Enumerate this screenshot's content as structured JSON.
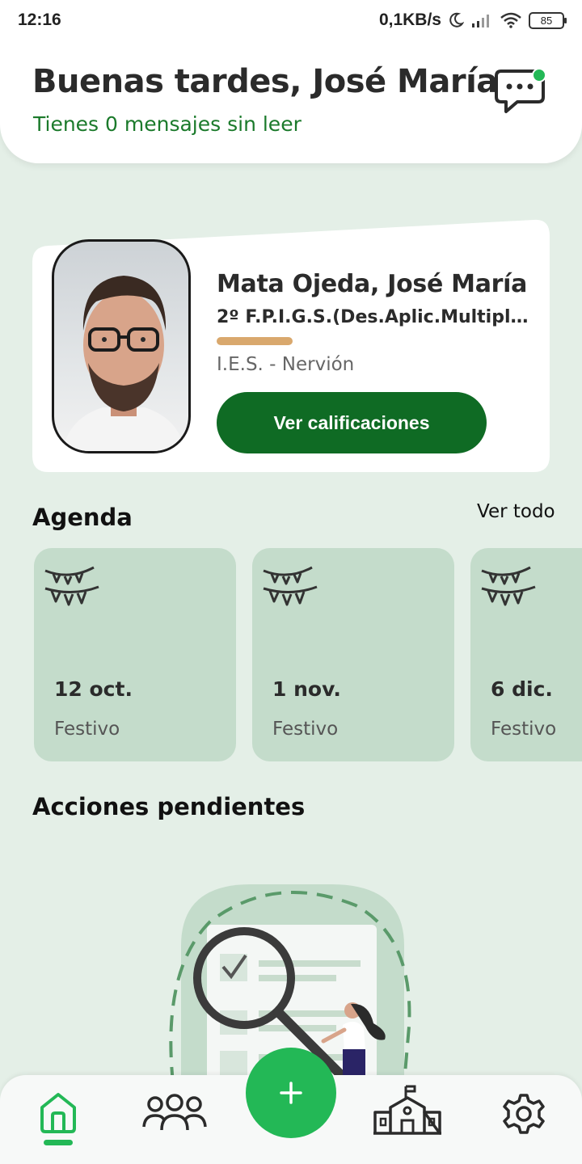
{
  "status_bar": {
    "time": "12:16",
    "network_speed": "0,1KB/s",
    "battery": "85"
  },
  "header": {
    "greeting": "Buenas tardes, José María",
    "unread_messages": "Tienes 0 mensajes sin leer",
    "chat_icon": "chat-bubble-icon",
    "has_notification": true
  },
  "profile": {
    "name": "Mata Ojeda, José María",
    "course": "2º F.P.I.G.S.(Des.Aplic.Multipl…",
    "school": "I.E.S. - Nervión",
    "grades_button": "Ver calificaciones"
  },
  "agenda": {
    "title": "Agenda",
    "see_all": "Ver todo",
    "items": [
      {
        "date": "12 oct.",
        "type": "Festivo",
        "icon": "bunting-icon"
      },
      {
        "date": "1 nov.",
        "type": "Festivo",
        "icon": "bunting-icon"
      },
      {
        "date": "6 dic.",
        "type": "Festivo",
        "icon": "bunting-icon"
      }
    ]
  },
  "pending": {
    "title": "Acciones pendientes",
    "illustration": "search-document-illustration"
  },
  "nav": {
    "items": [
      {
        "icon": "home-icon",
        "active": true
      },
      {
        "icon": "people-icon",
        "active": false
      },
      {
        "icon": "plus-icon",
        "active": false
      },
      {
        "icon": "school-icon",
        "active": false
      },
      {
        "icon": "gear-icon",
        "active": false
      }
    ]
  },
  "colors": {
    "background": "#e4efe7",
    "accent_green": "#23b856",
    "dark_green": "#0f6b24",
    "card_green": "#c4dccb",
    "course_bar": "#d9a86d"
  }
}
